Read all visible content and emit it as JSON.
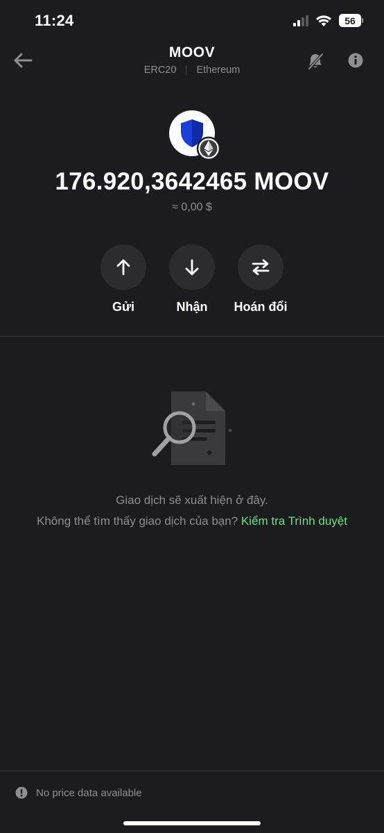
{
  "status_bar": {
    "time": "11:24",
    "battery": "56"
  },
  "header": {
    "title": "MOOV",
    "standard": "ERC20",
    "network": "Ethereum"
  },
  "token": {
    "balance": "176.920,3642465 MOOV",
    "fiat_value": "≈ 0,00 $"
  },
  "actions": {
    "send": "Gửi",
    "receive": "Nhận",
    "swap": "Hoán đổi"
  },
  "empty_state": {
    "line1": "Giao dịch sẽ xuất hiện ở đây.",
    "line2": "Không thể tìm thấy giao dịch của bạn?",
    "link": "Kiểm tra Trình duyệt"
  },
  "footer": {
    "note": "No price data available"
  },
  "colors": {
    "background": "#1c1c1e",
    "accent_link": "#6ee08a",
    "muted_text": "#8e8e93",
    "token_shield": "#1a3fd6"
  },
  "icons": {
    "back": "arrow-left-icon",
    "bell_off": "bell-off-icon",
    "info": "info-icon",
    "send": "arrow-up-icon",
    "receive": "arrow-down-icon",
    "swap": "swap-icon",
    "warning": "exclamation-circle-icon"
  }
}
